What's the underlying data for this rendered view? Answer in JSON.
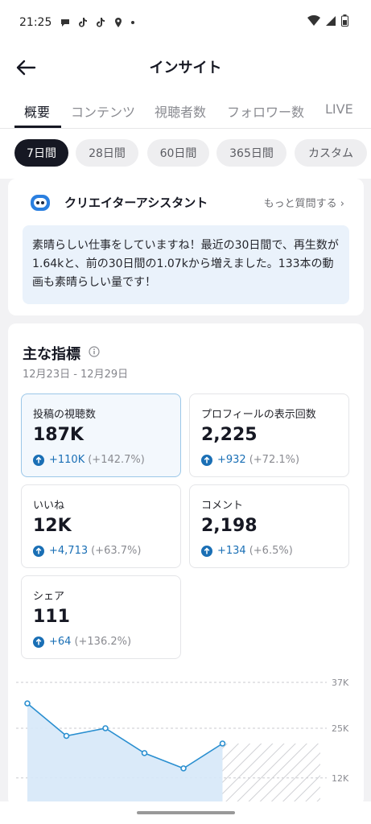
{
  "status": {
    "time": "21:25"
  },
  "header": {
    "title": "インサイト"
  },
  "tabs": [
    {
      "label": "概要",
      "active": true
    },
    {
      "label": "コンテンツ"
    },
    {
      "label": "視聴者数"
    },
    {
      "label": "フォロワー数"
    },
    {
      "label": "LIVE"
    }
  ],
  "ranges": [
    {
      "label": "7日間",
      "active": true
    },
    {
      "label": "28日間"
    },
    {
      "label": "60日間"
    },
    {
      "label": "365日間"
    },
    {
      "label": "カスタム"
    }
  ],
  "assistant": {
    "title": "クリエイターアシスタント",
    "more": "もっと質問する ›",
    "message": "素晴らしい仕事をしていますね！最近の30日間で、再生数が1.64kと、前の30日間の1.07kから増えました。133本の動画も素晴らしい量です！"
  },
  "metrics": {
    "title": "主な指標",
    "date_range": "12月23日 - 12月29日",
    "items": [
      {
        "label": "投稿の視聴数",
        "value": "187K",
        "change": "+110K",
        "pct": "(+142.7%)"
      },
      {
        "label": "プロフィールの表示回数",
        "value": "2,225",
        "change": "+932",
        "pct": "(+72.1%)"
      },
      {
        "label": "いいね",
        "value": "12K",
        "change": "+4,713",
        "pct": "(+63.7%)"
      },
      {
        "label": "コメント",
        "value": "2,198",
        "change": "+134",
        "pct": "(+6.5%)"
      },
      {
        "label": "シェア",
        "value": "111",
        "change": "+64",
        "pct": "(+136.2%)"
      }
    ]
  },
  "colors": {
    "accent": "#1a6fb5",
    "line": "#2a8fd0",
    "fill": "#d6e8f8"
  },
  "chart_data": {
    "type": "line",
    "y_ticks": [
      "37K",
      "25K",
      "12K"
    ],
    "y_values": [
      37000,
      25000,
      12000
    ],
    "series": [
      {
        "values": [
          31500,
          23000,
          25000,
          18500,
          14500,
          21000
        ]
      }
    ],
    "ylim": [
      0,
      37000
    ],
    "grid": true
  }
}
